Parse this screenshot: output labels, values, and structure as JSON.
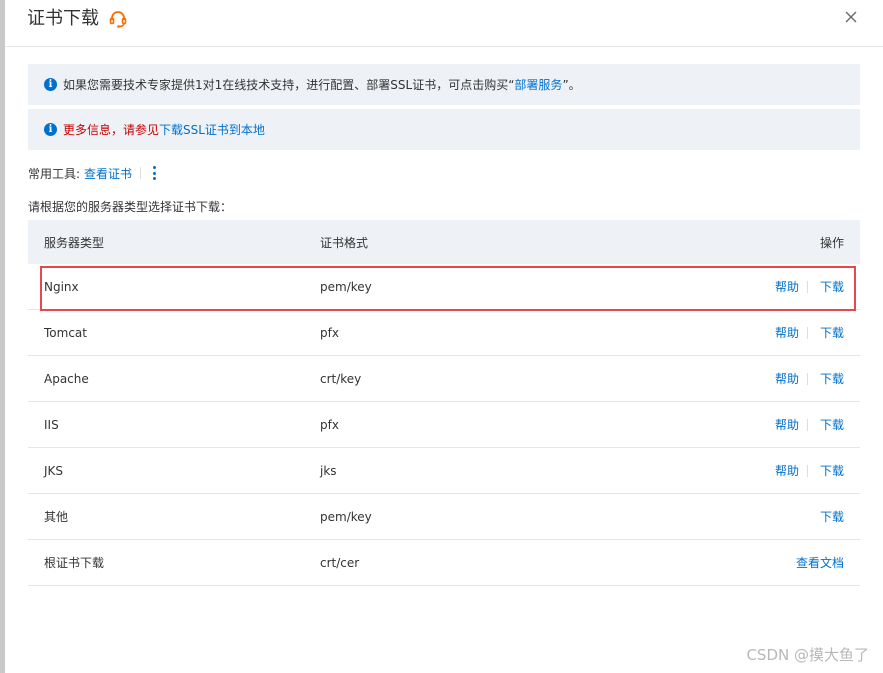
{
  "dialog": {
    "title": "证书下载",
    "close_label": "×"
  },
  "notices": {
    "n1_text": "如果您需要技术专家提供1对1在线技术支持，进行配置、部署SSL证书，可点击购买“",
    "n1_link": "部署服务",
    "n1_tail": "”。",
    "n2_red": "更多信息，请参见",
    "n2_link": "下载SSL证书到本地"
  },
  "tools": {
    "label": "常用工具:",
    "view_cert": "查看证书"
  },
  "prompt": "请根据您的服务器类型选择证书下载：",
  "table": {
    "headers": [
      "服务器类型",
      "证书格式",
      "操作"
    ],
    "rows": [
      {
        "server": "Nginx",
        "format": "pem/key",
        "help": "帮助",
        "download": "下载"
      },
      {
        "server": "Tomcat",
        "format": "pfx",
        "help": "帮助",
        "download": "下载"
      },
      {
        "server": "Apache",
        "format": "crt/key",
        "help": "帮助",
        "download": "下载"
      },
      {
        "server": "IIS",
        "format": "pfx",
        "help": "帮助",
        "download": "下载"
      },
      {
        "server": "JKS",
        "format": "jks",
        "help": "帮助",
        "download": "下载"
      },
      {
        "server": "其他",
        "format": "pem/key",
        "help": "",
        "download": "下载"
      },
      {
        "server": "根证书下载",
        "format": "crt/cer",
        "help": "",
        "download": "查看文档"
      }
    ]
  },
  "watermark": "CSDN @摸大鱼了",
  "colors": {
    "link": "#0070cc",
    "notice_bg": "#eef2f7",
    "highlight": "#e5484d",
    "support_icon": "#ff6a00"
  }
}
